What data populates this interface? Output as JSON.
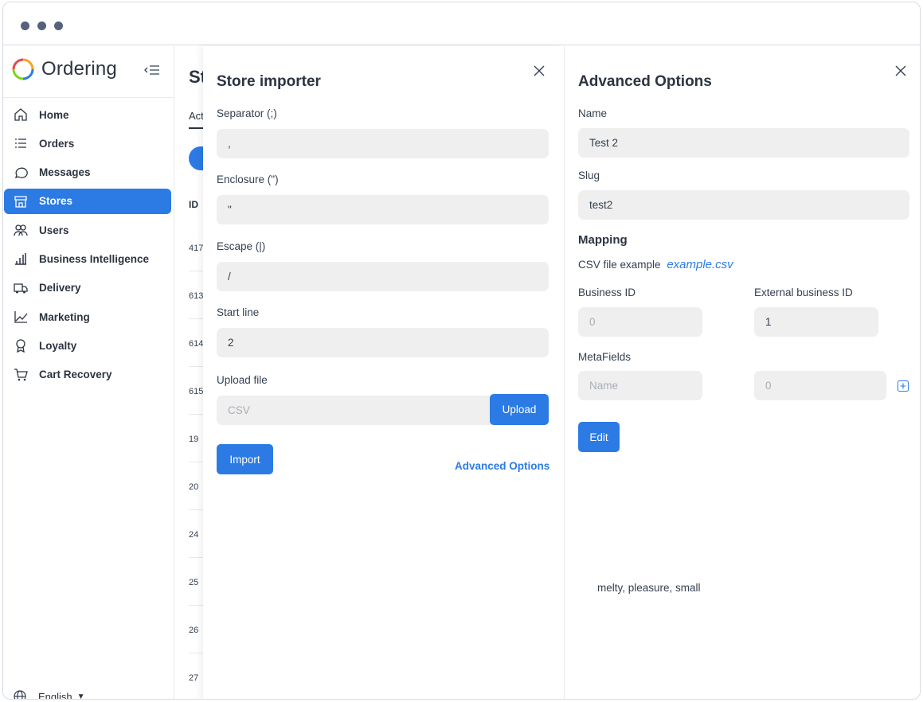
{
  "sidebar": {
    "logo_text": "Ordering",
    "items": [
      {
        "label": "Home",
        "icon": "home-icon"
      },
      {
        "label": "Orders",
        "icon": "list-icon"
      },
      {
        "label": "Messages",
        "icon": "chat-icon"
      },
      {
        "label": "Stores",
        "icon": "store-icon",
        "active": true
      },
      {
        "label": "Users",
        "icon": "users-icon"
      },
      {
        "label": "Business Intelligence",
        "icon": "bar-chart-icon"
      },
      {
        "label": "Delivery",
        "icon": "truck-icon"
      },
      {
        "label": "Marketing",
        "icon": "graph-icon"
      },
      {
        "label": "Loyalty",
        "icon": "award-icon"
      },
      {
        "label": "Cart Recovery",
        "icon": "cart-icon"
      }
    ],
    "language": "English"
  },
  "background": {
    "title": "St",
    "tab": "Act",
    "id_header": "ID",
    "rows": [
      "417",
      "613",
      "614",
      "615",
      "19",
      "20",
      "24",
      "25",
      "26",
      "27"
    ]
  },
  "importer": {
    "title": "Store importer",
    "separator_label": "Separator (;)",
    "separator_value": ",",
    "enclosure_label": "Enclosure (\")",
    "enclosure_value": "\"",
    "escape_label": "Escape (|)",
    "escape_value": "/",
    "start_line_label": "Start line",
    "start_line_value": "2",
    "upload_label": "Upload file",
    "upload_placeholder": "CSV",
    "upload_button": "Upload",
    "import_button": "Import",
    "advanced_link": "Advanced Options"
  },
  "advanced": {
    "title": "Advanced Options",
    "name_label": "Name",
    "name_value": "Test 2",
    "slug_label": "Slug",
    "slug_value": "test2",
    "mapping_title": "Mapping",
    "csv_example_label": "CSV file example",
    "csv_example_link": "example.csv",
    "business_id_label": "Business ID",
    "business_id_placeholder": "0",
    "external_id_label": "External business ID",
    "external_id_value": "1",
    "metafields_label": "MetaFields",
    "metafield_name_placeholder": "Name",
    "metafield_value_placeholder": "0",
    "edit_button": "Edit",
    "footer_text": "melty, pleasure, small"
  },
  "colors": {
    "accent": "#2c7be5",
    "field_bg": "#efefef",
    "text": "#2c3440"
  }
}
